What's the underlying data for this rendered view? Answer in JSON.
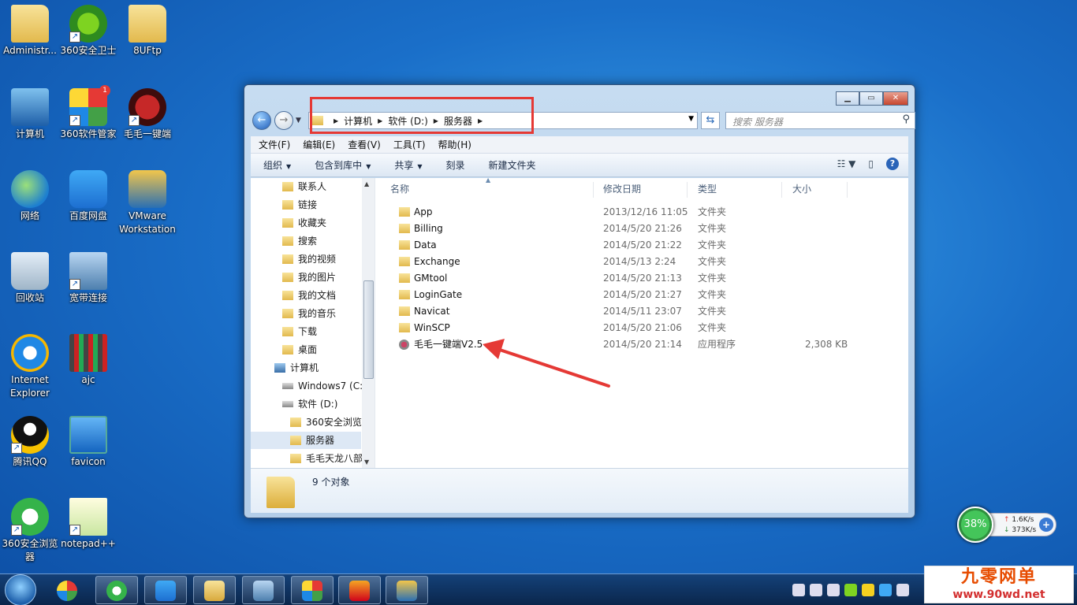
{
  "desktop": {
    "icons": [
      {
        "label": "Administr...",
        "icon": "user-folder-icon"
      },
      {
        "label": "360安全卫士",
        "icon": "shield-plus-icon"
      },
      {
        "label": "8UFtp",
        "icon": "folder-icon"
      },
      {
        "label": "计算机",
        "icon": "computer-icon"
      },
      {
        "label": "360软件管家",
        "icon": "tiles-icon"
      },
      {
        "label": "毛毛一键端",
        "icon": "dragon-icon"
      },
      {
        "label": "网络",
        "icon": "network-icon"
      },
      {
        "label": "百度网盘",
        "icon": "cloud-icon"
      },
      {
        "label": "VMware Workstation",
        "icon": "vmware-icon"
      },
      {
        "label": "回收站",
        "icon": "recycle-bin-icon"
      },
      {
        "label": "宽带连接",
        "icon": "broadband-icon"
      },
      {
        "label": "Internet Explorer",
        "icon": "ie-icon"
      },
      {
        "label": "ajc",
        "icon": "jpeg-icon"
      },
      {
        "label": "腾讯QQ",
        "icon": "qq-icon"
      },
      {
        "label": "favicon",
        "icon": "image-icon"
      },
      {
        "label": "360安全浏览器",
        "icon": "browser-icon"
      },
      {
        "label": "notepad++",
        "icon": "notepad-icon"
      }
    ],
    "badge": "1"
  },
  "window": {
    "breadcrumb": [
      "计算机",
      "软件 (D:)",
      "服务器"
    ],
    "search_placeholder": "搜索 服务器",
    "menu": [
      "文件(F)",
      "编辑(E)",
      "查看(V)",
      "工具(T)",
      "帮助(H)"
    ],
    "toolbar": {
      "organize": "组织",
      "include_library": "包含到库中",
      "share": "共享",
      "burn": "刻录",
      "new_folder": "新建文件夹"
    },
    "tree": [
      "联系人",
      "链接",
      "收藏夹",
      "搜索",
      "我的视频",
      "我的图片",
      "我的文档",
      "我的音乐",
      "下载",
      "桌面",
      "计算机",
      "Windows7 (C:",
      "软件 (D:)",
      "360安全浏览",
      "服务器",
      "毛毛天龙八部"
    ],
    "columns": {
      "name": "名称",
      "modified": "修改日期",
      "type": "类型",
      "size": "大小"
    },
    "files": [
      {
        "name": "App",
        "date": "2013/12/16 11:05",
        "type": "文件夹",
        "size": ""
      },
      {
        "name": "Billing",
        "date": "2014/5/20 21:26",
        "type": "文件夹",
        "size": ""
      },
      {
        "name": "Data",
        "date": "2014/5/20 21:22",
        "type": "文件夹",
        "size": ""
      },
      {
        "name": "Exchange",
        "date": "2014/5/13 2:24",
        "type": "文件夹",
        "size": ""
      },
      {
        "name": "GMtool",
        "date": "2014/5/20 21:13",
        "type": "文件夹",
        "size": ""
      },
      {
        "name": "LoginGate",
        "date": "2014/5/20 21:27",
        "type": "文件夹",
        "size": ""
      },
      {
        "name": "Navicat",
        "date": "2014/5/11 23:07",
        "type": "文件夹",
        "size": ""
      },
      {
        "name": "WinSCP",
        "date": "2014/5/20 21:06",
        "type": "文件夹",
        "size": ""
      },
      {
        "name": "毛毛一键端V2.5",
        "date": "2014/5/20 21:14",
        "type": "应用程序",
        "size": "2,308 KB"
      }
    ],
    "status": "9 个对象"
  },
  "net_widget": {
    "percent": "38%",
    "upload": "1.6K/s",
    "download": "373K/s"
  },
  "watermark": {
    "title": "九零网单",
    "url": "www.90wd.net"
  }
}
